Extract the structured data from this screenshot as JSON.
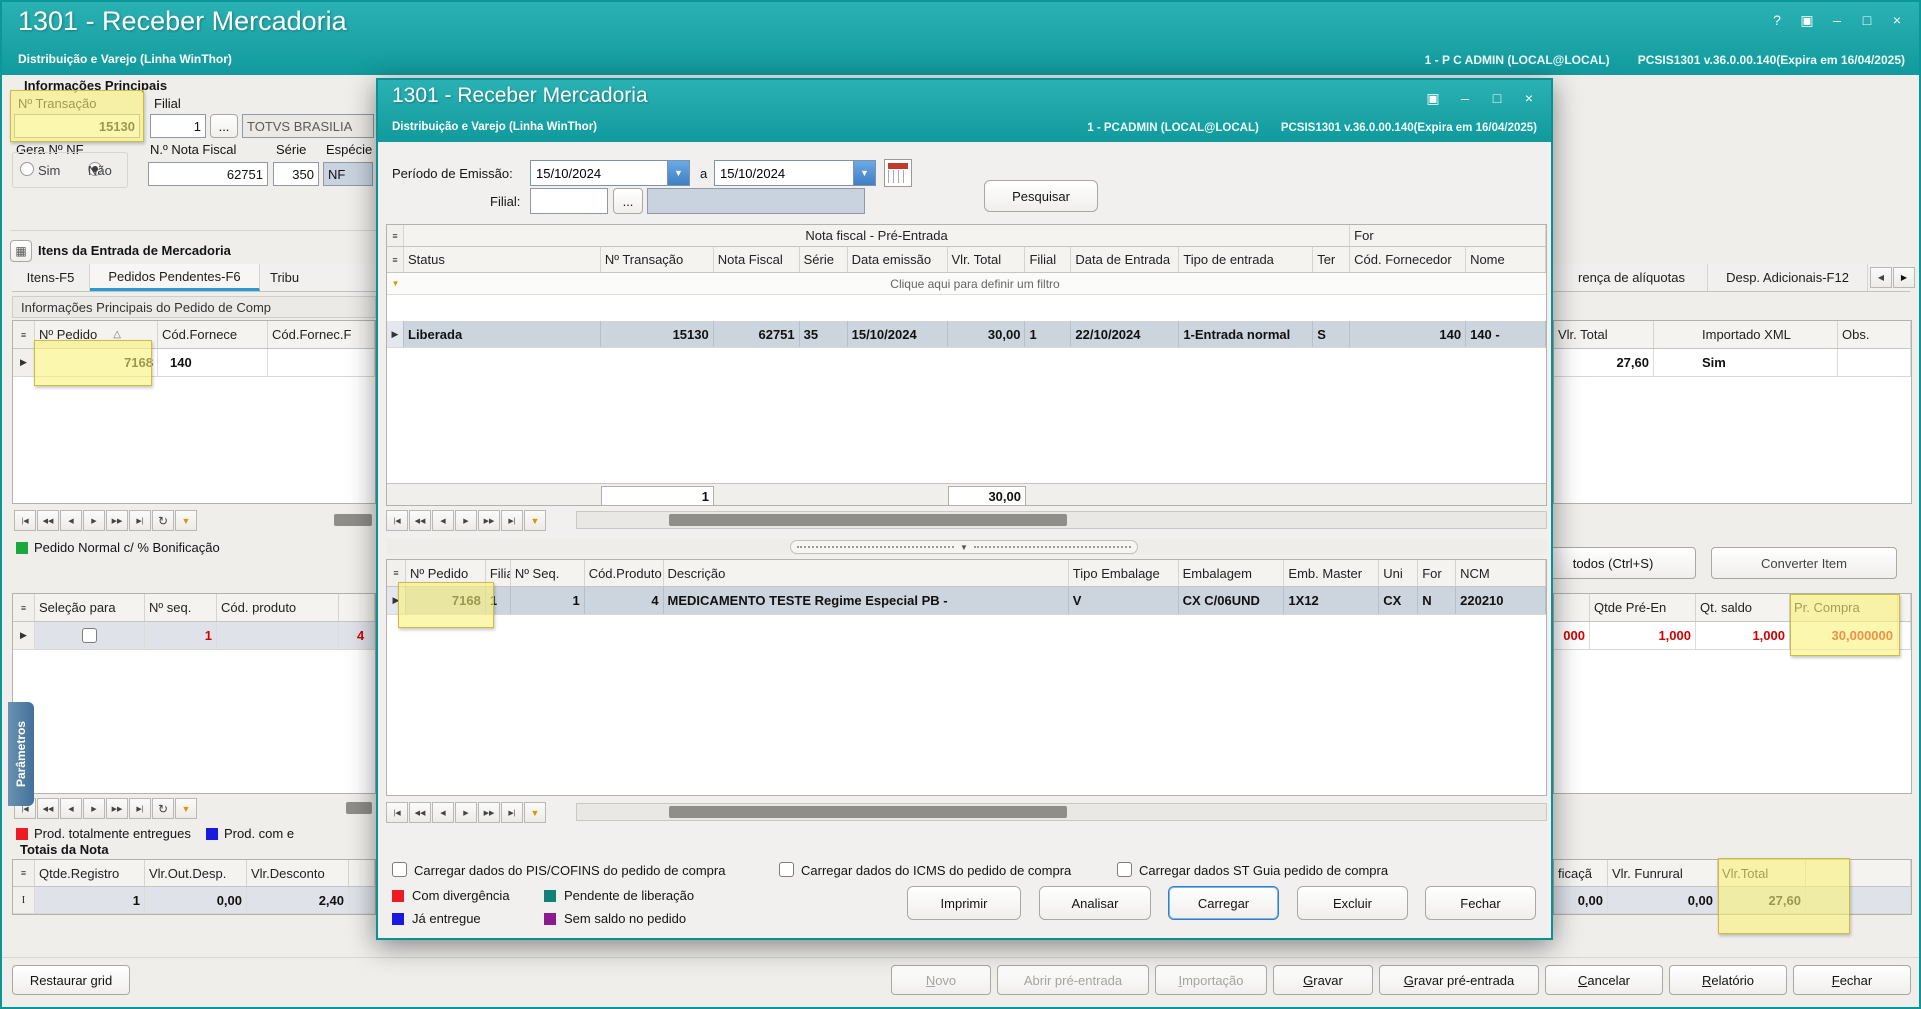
{
  "icons": {
    "help": "?",
    "panel": "▣",
    "minimize": "–",
    "maximize": "□",
    "close": "×",
    "restore": "▣",
    "dropdown": "▼",
    "browse": "...",
    "funnel": "▼",
    "refresh": "↻",
    "nav_first": "|◀",
    "nav_prev2": "◀◀",
    "nav_prev": "◀",
    "nav_next": "▶",
    "nav_next2": "▶▶",
    "nav_last": "▶|",
    "sort_asc": "△",
    "row_arrow": "▶",
    "row_ibeam": "I",
    "grid_corner": "≡",
    "grid_window": "▦",
    "scroll_left": "◀",
    "scroll_right": "▶",
    "splitter_collapse": "▼"
  },
  "win": {
    "title": "1301 - Receber Mercadoria",
    "subtitle": "Distribuição e Varejo (Linha WinThor)",
    "user": "1 - P C ADMIN (LOCAL@LOCAL)",
    "version": "PCSIS1301  v.36.0.00.140(Expira em 16/04/2025)"
  },
  "left": {
    "info_title": "Informações Principais",
    "transacao_label": "Nº Transação",
    "transacao_value": "15130",
    "filial_label": "Filial",
    "filial_value": "1",
    "filial_name": "TOTVS BRASILIA",
    "gera_label": "Gera Nº NF",
    "radio_sim": "Sim",
    "radio_nao": "Não",
    "nf_label": "N.º Nota Fiscal",
    "nf_value": "62751",
    "serie_label": "Série",
    "serie_value": "350",
    "especie_label": "Espécie",
    "especie_value": "NF",
    "itens_title": "Itens da Entrada de Mercadoria",
    "tab_itens": "Itens-F5",
    "tab_pedidos": "Pedidos Pendentes-F6",
    "tab_tribut": "Tribu",
    "pedido_info_header": "Informações Principais do Pedido de Comp",
    "gpa_h_pedido": "Nº Pedido",
    "gpa_h_forn1": "Cód.Fornece",
    "gpa_h_forn2": "Cód.Fornec.F",
    "gpa_v_pedido": "7168",
    "gpa_v_forn": "140",
    "legend_green": "Pedido Normal c/ % Bonificação",
    "gpb_h_sel": "Seleção para",
    "gpb_h_seq": "Nº seq.",
    "gpb_h_prod": "Cód. produto",
    "gpb_v_seq": "1",
    "gpb_v_prod": "4",
    "legend_red": "Prod. totalmente entregues",
    "legend_blue": "Prod. com e",
    "totais_title": "Totais da Nota",
    "gpc_h_qtde": "Qtde.Registro",
    "gpc_h_outdesp": "Vlr.Out.Desp.",
    "gpc_h_desc": "Vlr.Desconto",
    "gpc_v_qtde": "1",
    "gpc_v_outdesp": "0,00",
    "gpc_v_desc": "2,40",
    "parametros": "Parâmetros"
  },
  "right": {
    "tab_aliq": "rença de alíquotas",
    "tab_desp": "Desp. Adicionais-F12",
    "ga_h_total": "Vlr. Total",
    "ga_h_xml": "Importado XML",
    "ga_h_obs": "Obs.",
    "ga_v_total": "27,60",
    "ga_v_xml": "Sim",
    "btn_todos": "todos (Ctrl+S)",
    "btn_converter": "Converter Item",
    "gb_v_cut": "000",
    "gb_h_qtde": "Qtde Pré-En",
    "gb_h_saldo": "Qt. saldo",
    "gb_h_compra": "Pr. Compra",
    "gb_v_qtde": "1,000",
    "gb_v_saldo": "1,000",
    "gb_v_compra": "30,000000",
    "gc_h_1": "ficaçã",
    "gc_h_2": "Vlr. Funrural",
    "gc_h_3": "Vlr.Total",
    "gc_v_1": "0,00",
    "gc_v_2": "0,00",
    "gc_v_3": "27,60"
  },
  "bottom": {
    "restaurar": "Restaurar grid",
    "novo": "Novo",
    "abrir": "Abrir pré-entrada",
    "importacao": "Importação",
    "gravar": "Gravar",
    "gravar_pre": "Gravar pré-entrada",
    "cancelar": "Cancelar",
    "relatorio": "Relatório",
    "fechar": "Fechar"
  },
  "modal": {
    "title": "1301 - Receber Mercadoria",
    "subtitle": "Distribuição e Varejo (Linha WinThor)",
    "user": "1 - PCADMIN (LOCAL@LOCAL)",
    "version": "PCSIS1301  v.36.0.00.140(Expira em 16/04/2025)",
    "periodo_label": "Período de Emissão:",
    "periodo_de": "15/10/2024",
    "periodo_a": "a",
    "periodo_ate": "15/10/2024",
    "filial_label": "Filial:",
    "filial_value": "",
    "pesquisar": "Pesquisar",
    "g1_band1": "Nota fiscal - Pré-Entrada",
    "g1_band2": "For",
    "g1_h": [
      "Status",
      "Nº Transação",
      "Nota Fiscal",
      "Série",
      "Data emissão",
      "Vlr. Total",
      "Filial",
      "Data de Entrada",
      "Tipo de entrada",
      "Ter",
      "Cód. Fornecedor",
      "Nome"
    ],
    "g1_filter": "Clique aqui para definir um filtro",
    "g1_r": [
      "Liberada",
      "15130",
      "62751",
      "35",
      "15/10/2024",
      "30,00",
      "1",
      "22/10/2024",
      "1-Entrada normal",
      "S",
      "140",
      "140 -"
    ],
    "g1_foot_count": "1",
    "g1_foot_total": "30,00",
    "g2_h": [
      "Nº Pedido",
      "Filia",
      "Nº Seq.",
      "Cód.Produto",
      "Descrição",
      "Tipo Embalage",
      "Embalagem",
      "Emb. Master",
      "Uni",
      "For",
      "NCM"
    ],
    "g2_r": [
      "7168",
      "1",
      "1",
      "4",
      "MEDICAMENTO TESTE Regime Especial PB -",
      "V",
      "CX C/06UND",
      "1X12",
      "CX",
      "N",
      "220210"
    ],
    "cb1": "Carregar dados do PIS/COFINS do pedido de compra",
    "cb2": "Carregar dados do ICMS do pedido de compra",
    "cb3": "Carregar dados ST Guia pedido de compra",
    "lg1": "Com divergência",
    "lg2": "Pendente de liberação",
    "lg3": "Já entregue",
    "lg4": "Sem saldo no pedido",
    "b_imprimir": "Imprimir",
    "b_analisar": "Analisar",
    "b_carregar": "Carregar",
    "b_excluir": "Excluir",
    "b_fechar": "Fechar"
  },
  "colors": {
    "titlebar": "#17a0a3",
    "highlight": "#f6ef9a",
    "selected_row": "#ccd4de",
    "legend_green": "#18a83c",
    "legend_red": "#ed1c24",
    "legend_blue": "#1a1adf",
    "legend_teal": "#128076",
    "legend_purple": "#8c1a8c",
    "value_red": "#d40000"
  }
}
